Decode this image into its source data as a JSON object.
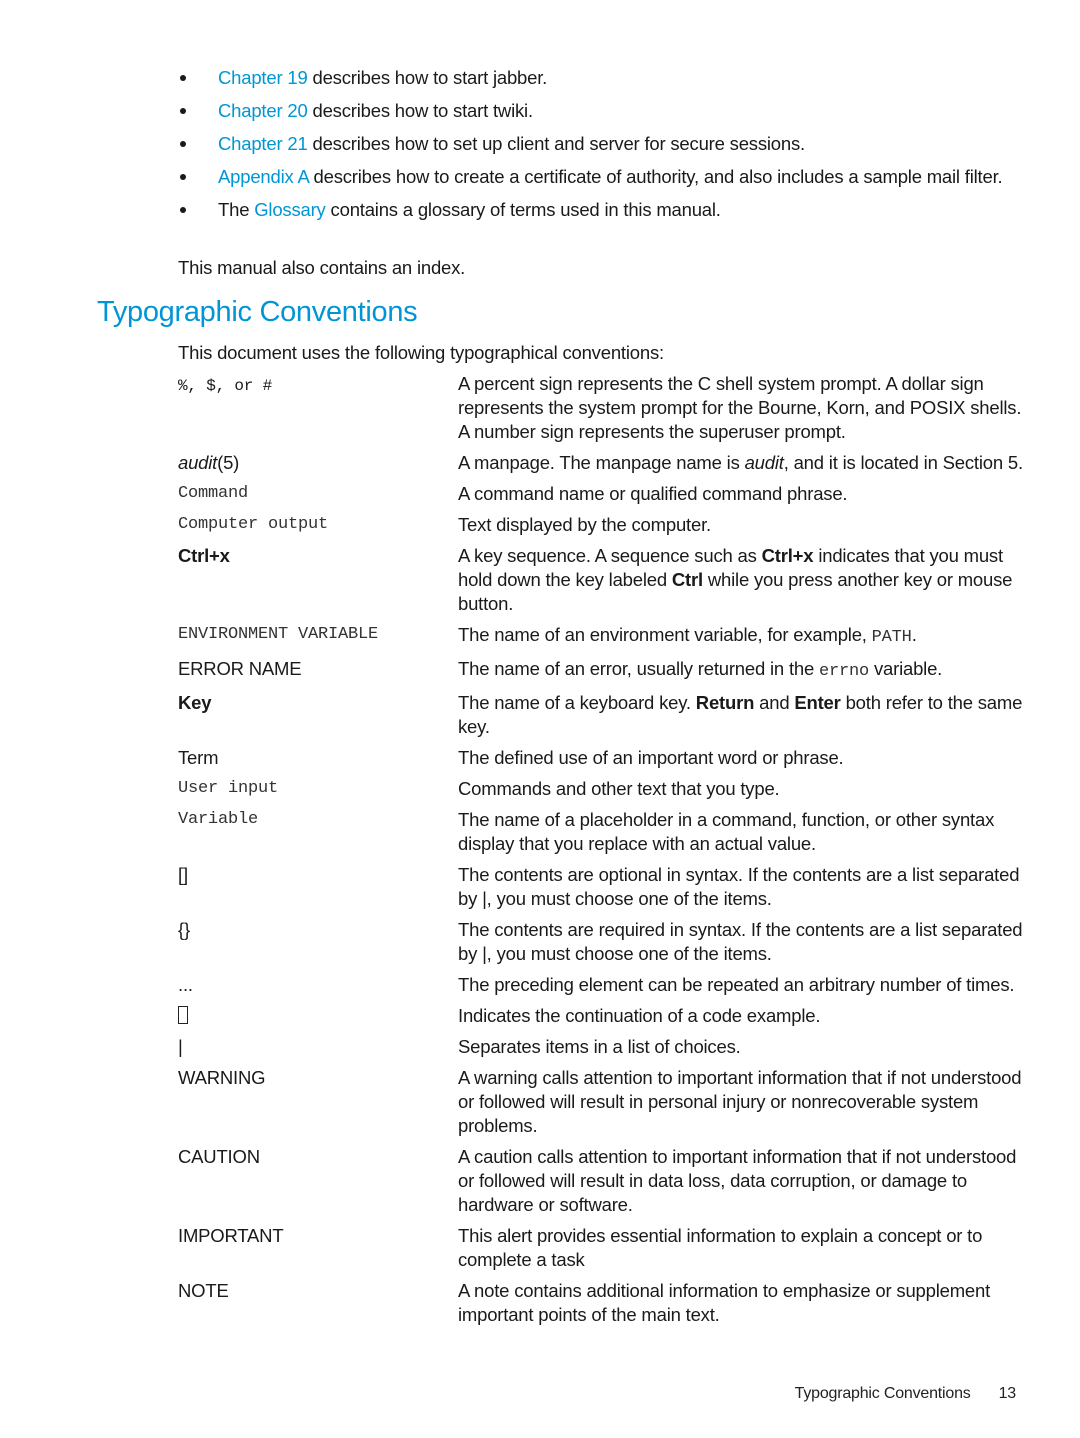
{
  "document": {
    "overview_items": [
      {
        "link": "Chapter 19",
        "text": " describes how to start jabber."
      },
      {
        "link": "Chapter 20",
        "text": " describes how to start twiki."
      },
      {
        "link": "Chapter 21",
        "text": " describes how to set up client and server for secure sessions."
      },
      {
        "link": "Appendix A",
        "text": " describes how to create a certificate of authority, and also includes a sample mail filter."
      },
      {
        "prefix": "The ",
        "link": "Glossary",
        "text": "  contains a glossary of terms used in this manual."
      }
    ],
    "index_note": "This manual also contains an index.",
    "section_title": "Typographic Conventions",
    "section_intro": "This document uses the following typographical conventions:",
    "conventions": [
      {
        "term": "%, $, or #",
        "desc": "A percent sign represents the C shell system prompt. A dollar sign represents the system prompt for the Bourne, Korn, and POSIX shells. A number sign represents the superuser prompt."
      },
      {
        "term_italic": "audit",
        "term_rest": "(5)",
        "desc_a": "A manpage. The manpage name is ",
        "desc_italic": "audit",
        "desc_b": ", and it is located in Section 5."
      },
      {
        "term": "Command",
        "desc": "A command name or qualified command phrase."
      },
      {
        "term": "Computer output",
        "desc": "Text displayed by the computer."
      },
      {
        "term": "Ctrl+x",
        "desc_a": "A key sequence. A sequence such as ",
        "desc_bold1": "Ctrl+x",
        "desc_b": " indicates that you must hold down the key labeled ",
        "desc_bold2": "Ctrl",
        "desc_c": " while you press another key or mouse button."
      },
      {
        "term": "ENVIRONMENT VARIABLE",
        "desc_a": "The name of an environment variable, for example, ",
        "desc_mono": "PATH",
        "desc_b": "."
      },
      {
        "term": "ERROR NAME",
        "desc_a": "The name of an error, usually returned in the ",
        "desc_mono": "errno",
        "desc_b": " variable."
      },
      {
        "term": "Key",
        "desc_a": "The name of a keyboard key. ",
        "desc_bold1": "Return",
        "desc_b": " and ",
        "desc_bold2": "Enter",
        "desc_c": " both refer to the same key."
      },
      {
        "term": "Term",
        "desc": "The defined use of an important word or phrase."
      },
      {
        "term": "User input",
        "desc": "Commands and other text that you type."
      },
      {
        "term": "Variable",
        "desc": "The name of a placeholder in a command, function, or other syntax display that you replace with an actual value."
      },
      {
        "term": "[]",
        "desc": "The contents are optional in syntax. If the contents are a list separated by |, you must choose one of the items."
      },
      {
        "term": "{}",
        "desc": "The contents are required in syntax. If the contents are a list separated by |, you must choose one of the items."
      },
      {
        "term": "...",
        "desc": "The preceding element can be repeated an arbitrary number of times."
      },
      {
        "term_icon": "continuation-box",
        "desc": "Indicates the continuation of a code example."
      },
      {
        "term": "|",
        "desc": "Separates items in a list of choices."
      },
      {
        "term": "WARNING",
        "desc": "A warning calls attention to important information that if not understood or followed will result in personal injury or nonrecoverable system problems."
      },
      {
        "term": "CAUTION",
        "desc": "A caution calls attention to important information that if not understood or followed will result in data loss, data corruption, or damage to hardware or software."
      },
      {
        "term": "IMPORTANT",
        "desc": "This alert provides essential information to explain a concept or to complete a task"
      },
      {
        "term": "NOTE",
        "desc": "A note contains additional information to emphasize or supplement important points of the main text."
      }
    ],
    "footer": {
      "section": "Typographic Conventions",
      "page_number": "13"
    },
    "colors": {
      "link": "#0096d6",
      "heading": "#0096d6",
      "text": "#1a1a1a"
    }
  }
}
